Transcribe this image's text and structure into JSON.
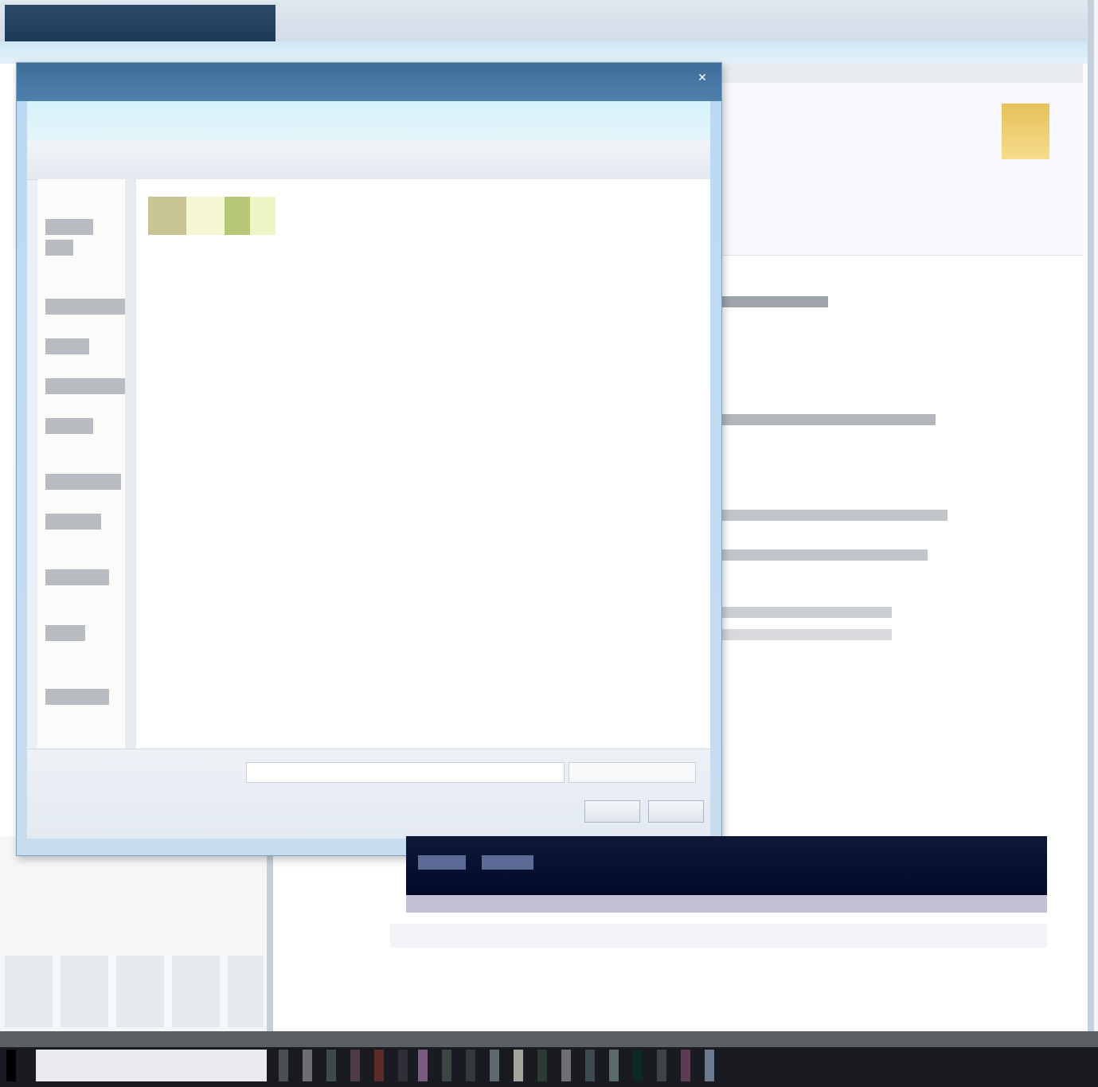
{
  "dialog": {
    "title": "",
    "address": "",
    "search_placeholder": "",
    "file_name_label": "",
    "file_name_value": "",
    "file_type_value": "",
    "open_label": "",
    "cancel_label": "",
    "items": [
      {
        "label": ""
      }
    ]
  },
  "colors": {
    "dialog_title": "#3f6d98",
    "taskbar": "#191b20",
    "banner": "#020a2a",
    "highlight": "#e6c15a"
  },
  "icons": [
    "folder-icon",
    "minimize-icon",
    "maximize-icon",
    "close-icon",
    "start-icon"
  ]
}
